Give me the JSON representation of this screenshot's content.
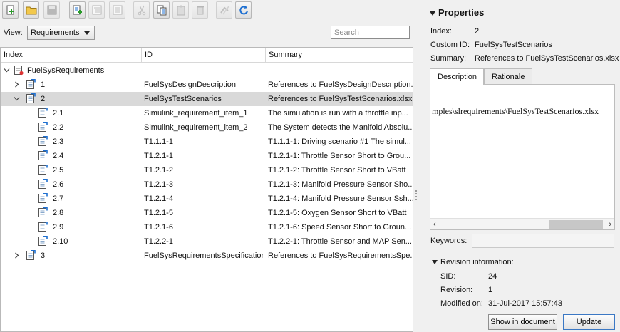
{
  "toolbar": {
    "buttons": [
      {
        "name": "new-requirement-set-icon",
        "enabled": true
      },
      {
        "name": "open-folder-icon",
        "enabled": true
      },
      {
        "name": "save-icon",
        "enabled": false
      },
      {
        "name": "add-requirement-icon",
        "enabled": true
      },
      {
        "name": "add-child-requirement-icon",
        "enabled": false
      },
      {
        "name": "add-justification-icon",
        "enabled": false
      },
      {
        "name": "cut-icon",
        "enabled": false
      },
      {
        "name": "copy-icon",
        "enabled": true
      },
      {
        "name": "paste-icon",
        "enabled": false
      },
      {
        "name": "delete-icon",
        "enabled": false
      },
      {
        "name": "link-icon",
        "enabled": false
      },
      {
        "name": "refresh-icon",
        "enabled": true
      }
    ]
  },
  "view": {
    "label": "View:",
    "selected": "Requirements"
  },
  "search": {
    "placeholder": "Search"
  },
  "table": {
    "columns": [
      "Index",
      "ID",
      "Summary"
    ],
    "root": {
      "label": "FuelSysRequirements",
      "icon": "requirement-set-icon",
      "expanded": true
    },
    "rows": [
      {
        "index": "1",
        "id": "FuelSysDesignDescription",
        "summary": "References to FuelSysDesignDescription...",
        "level": 1,
        "toggle": "collapsed",
        "selected": false
      },
      {
        "index": "2",
        "id": "FuelSysTestScenarios",
        "summary": "References to FuelSysTestScenarios.xlsx",
        "level": 1,
        "toggle": "expanded",
        "selected": true
      },
      {
        "index": "2.1",
        "id": "Simulink_requirement_item_1",
        "summary": "The simulation is run with a throttle inp...",
        "level": 2,
        "toggle": "none",
        "selected": false
      },
      {
        "index": "2.2",
        "id": "Simulink_requirement_item_2",
        "summary": "The System detects the Manifold Absolu...",
        "level": 2,
        "toggle": "none",
        "selected": false
      },
      {
        "index": "2.3",
        "id": "T1.1.1-1",
        "summary": "T1.1.1-1: Driving scenario #1 The simul...",
        "level": 2,
        "toggle": "none",
        "selected": false
      },
      {
        "index": "2.4",
        "id": "T1.2.1-1",
        "summary": "T1.2.1-1: Throttle Sensor Short to Grou...",
        "level": 2,
        "toggle": "none",
        "selected": false
      },
      {
        "index": "2.5",
        "id": "T1.2.1-2",
        "summary": "T1.2.1-2: Throttle Sensor Short to VBatt",
        "level": 2,
        "toggle": "none",
        "selected": false
      },
      {
        "index": "2.6",
        "id": "T1.2.1-3",
        "summary": "T1.2.1-3: Manifold Pressure Sensor Sho...",
        "level": 2,
        "toggle": "none",
        "selected": false
      },
      {
        "index": "2.7",
        "id": "T1.2.1-4",
        "summary": "T1.2.1-4: Manifold Pressure Sensor Ssh...",
        "level": 2,
        "toggle": "none",
        "selected": false
      },
      {
        "index": "2.8",
        "id": "T1.2.1-5",
        "summary": "T1.2.1-5: Oxygen Sensor Short to VBatt",
        "level": 2,
        "toggle": "none",
        "selected": false
      },
      {
        "index": "2.9",
        "id": "T1.2.1-6",
        "summary": "T1.2.1-6: Speed Sensor Short to Groun...",
        "level": 2,
        "toggle": "none",
        "selected": false
      },
      {
        "index": "2.10",
        "id": "T1.2.2-1",
        "summary": "T1.2.2-1: Throttle Sensor and MAP Sen...",
        "level": 2,
        "toggle": "none",
        "selected": false
      },
      {
        "index": "3",
        "id": "FuelSysRequirementsSpecification",
        "summary": "References to FuelSysRequirementsSpe...",
        "level": 1,
        "toggle": "collapsed",
        "selected": false
      }
    ]
  },
  "properties": {
    "title": "Properties",
    "index_label": "Index:",
    "index_value": "2",
    "custom_id_label": "Custom ID:",
    "custom_id_value": "FuelSysTestScenarios",
    "summary_label": "Summary:",
    "summary_value": "References to FuelSysTestScenarios.xlsx",
    "tabs": [
      "Description",
      "Rationale"
    ],
    "active_tab": "Description",
    "description_text": "mples\\slrequirements\\FuelSysTestScenarios.xlsx",
    "keywords_label": "Keywords:",
    "keywords_value": "",
    "revision": {
      "title": "Revision information:",
      "sid_label": "SID:",
      "sid_value": "24",
      "revision_label": "Revision:",
      "revision_value": "1",
      "modified_label": "Modified on:",
      "modified_value": "31-Jul-2017 15:57:43"
    },
    "show_in_document_label": "Show in document",
    "update_label": "Update"
  },
  "colors": {
    "selection": "#d9d9d9",
    "primary_border": "#3b78c4",
    "req_icon_blue": "#1d6fd1"
  }
}
